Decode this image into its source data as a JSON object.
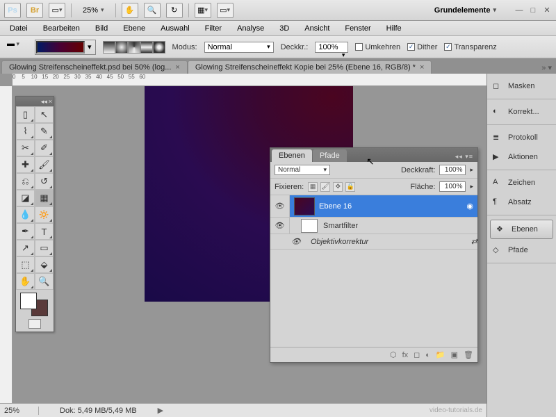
{
  "app": {
    "zoom_display": "25%",
    "workspace_name": "Grundelemente"
  },
  "menu": {
    "file": "Datei",
    "edit": "Bearbeiten",
    "image": "Bild",
    "layer": "Ebene",
    "select": "Auswahl",
    "filter": "Filter",
    "analysis": "Analyse",
    "view3d": "3D",
    "view": "Ansicht",
    "window": "Fenster",
    "help": "Hilfe"
  },
  "optbar": {
    "modus_label": "Modus:",
    "modus_value": "Normal",
    "opacity_label": "Deckkr.:",
    "opacity_value": "100%",
    "umkehren": "Umkehren",
    "dither": "Dither",
    "transparenz": "Transparenz"
  },
  "tabs": {
    "t1": "Glowing Streifenscheineffekt.psd bei 50% (log...",
    "t2": "Glowing Streifenscheineffekt Kopie bei 25% (Ebene 16, RGB/8) *"
  },
  "status": {
    "zoom": "25%",
    "doc": "Dok: 5,49 MB/5,49 MB"
  },
  "right": {
    "masken": "Masken",
    "korrekt": "Korrekt...",
    "protokoll": "Protokoll",
    "aktionen": "Aktionen",
    "zeichen": "Zeichen",
    "absatz": "Absatz",
    "ebenen": "Ebenen",
    "pfade": "Pfade"
  },
  "layers": {
    "tab_ebenen": "Ebenen",
    "tab_pfade": "Pfade",
    "blend": "Normal",
    "deckkraft_label": "Deckkraft:",
    "deckkraft_value": "100%",
    "fixieren": "Fixieren:",
    "flaeche_label": "Fläche:",
    "flaeche_value": "100%",
    "layer1": "Ebene 16",
    "smart": "Smartfilter",
    "lens": "Objektivkorrektur"
  },
  "watermark": "video-tutorials.de"
}
